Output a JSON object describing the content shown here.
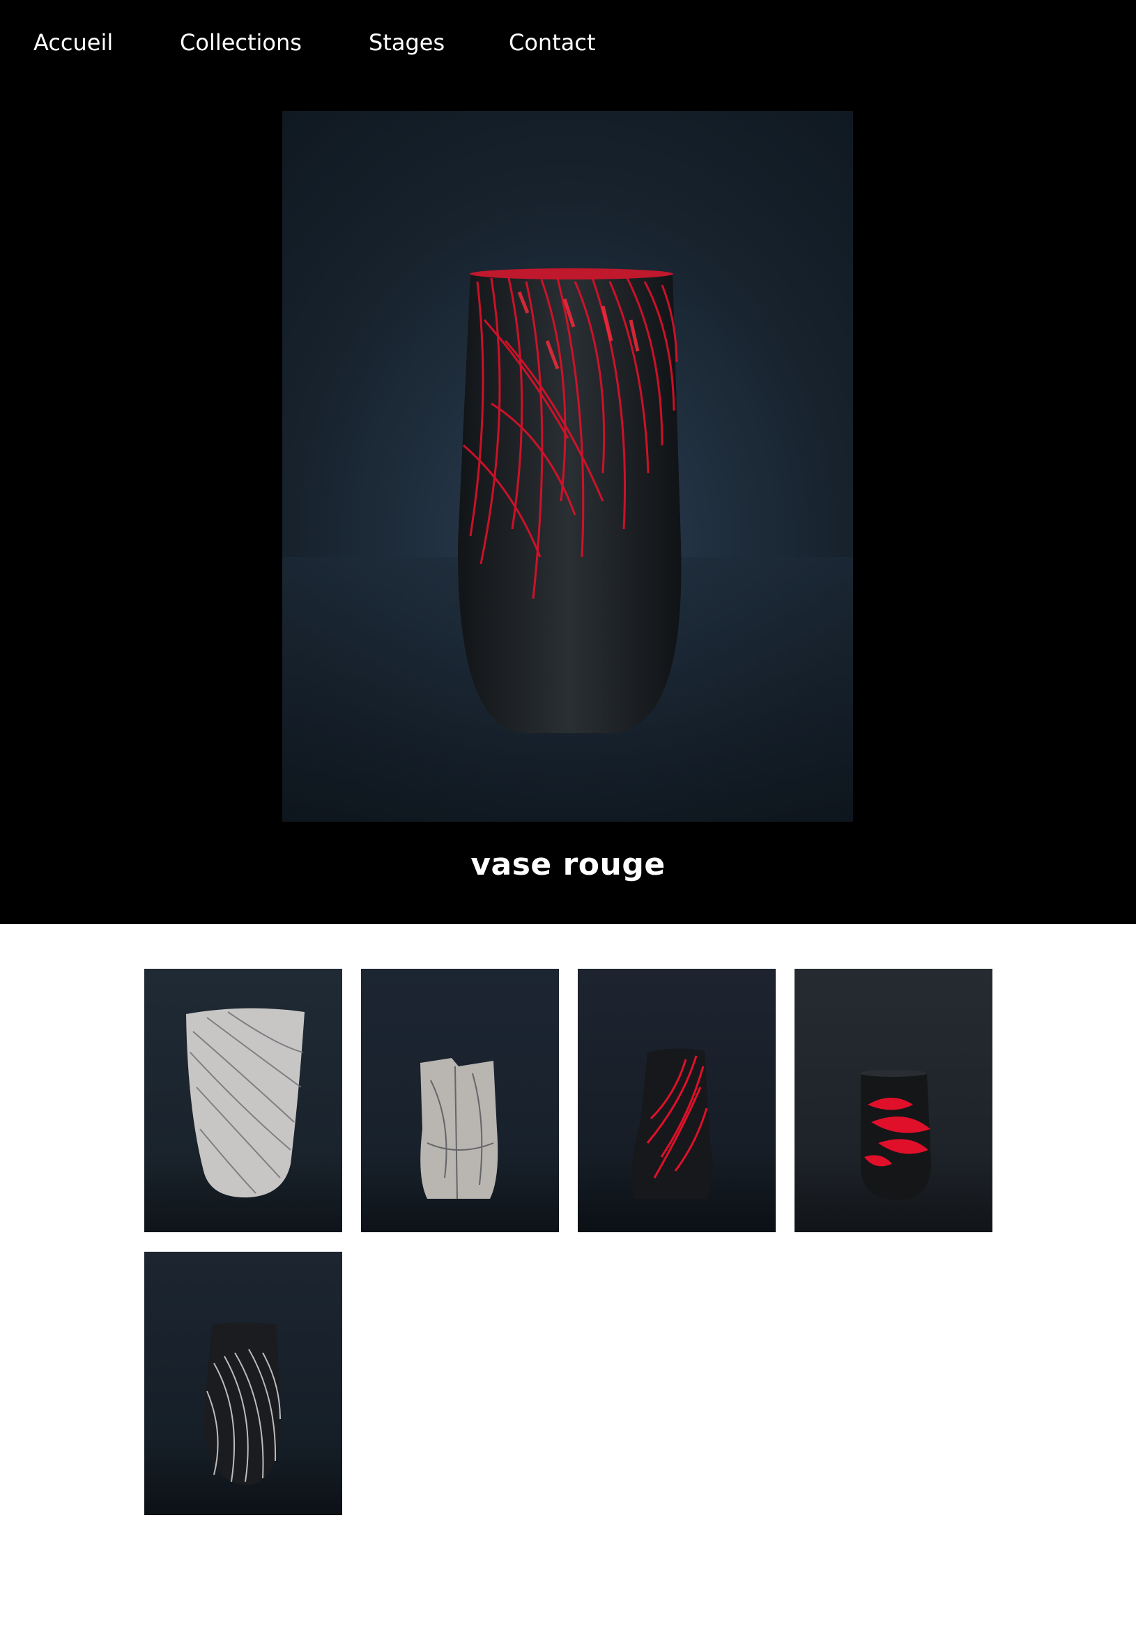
{
  "nav": {
    "items": [
      {
        "label": "Accueil"
      },
      {
        "label": "Collections"
      },
      {
        "label": "Stages"
      },
      {
        "label": "Contact"
      }
    ]
  },
  "artwork": {
    "title": "vase rouge",
    "image_alt": "Black ceramic vase with red glaze streaks on a dark blue background",
    "accent_color": "#e0102a"
  },
  "gallery": {
    "thumbnails": [
      {
        "alt": "White and grey crackled twisted vase"
      },
      {
        "alt": "White and grey folded sculptural vase"
      },
      {
        "alt": "Black twisted vase with red glaze lines"
      },
      {
        "alt": "Black round vase with red floral glaze"
      },
      {
        "alt": "Black vase with white streaks"
      }
    ]
  },
  "colors": {
    "hero_background": "#000000",
    "photo_background": "#1a2633",
    "page_background": "#ffffff"
  }
}
